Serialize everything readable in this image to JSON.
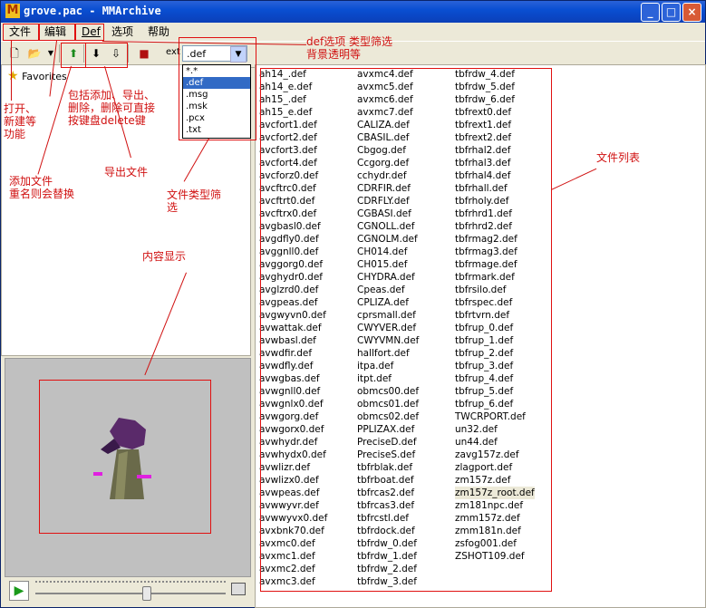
{
  "window": {
    "title": "grove.pac - MMArchive",
    "icon": "M"
  },
  "menubar": {
    "items": [
      "文件",
      "编辑",
      "Def",
      "选项",
      "帮助"
    ]
  },
  "toolbar": {
    "ext_label": "ext",
    "selected_filter": ".def"
  },
  "dropdown": {
    "options": [
      "*.*",
      ".def",
      ".msg",
      ".msk",
      ".pcx",
      ".txt"
    ]
  },
  "tree": {
    "favorites_label": "Favorites"
  },
  "files": {
    "col1": [
      "ah14_.def",
      "ah14_e.def",
      "ah15_.def",
      "ah15_e.def",
      "avcfort1.def",
      "avcfort2.def",
      "avcfort3.def",
      "avcfort4.def",
      "avcforz0.def",
      "avcftrc0.def",
      "avcftrt0.def",
      "avcftrx0.def",
      "avgbasl0.def",
      "avgdfly0.def",
      "avggnll0.def",
      "avggorg0.def",
      "avghydr0.def",
      "avglzrd0.def",
      "avgpeas.def",
      "avgwyvn0.def",
      "avwattak.def",
      "avwbasl.def",
      "avwdfir.def",
      "avwdfly.def",
      "avwgbas.def",
      "avwgnll0.def",
      "avwgnlx0.def",
      "avwgorg.def",
      "avwgorx0.def",
      "avwhydr.def",
      "avwhydx0.def",
      "avwlizr.def",
      "avwlizx0.def",
      "avwpeas.def",
      "avwwyvr.def",
      "avwwyvx0.def",
      "avxbnk70.def",
      "avxmc0.def",
      "avxmc1.def",
      "avxmc2.def",
      "avxmc3.def"
    ],
    "col2": [
      "avxmc4.def",
      "avxmc5.def",
      "avxmc6.def",
      "avxmc7.def",
      "CALIZA.def",
      "CBASIL.def",
      "Cbgog.def",
      "Ccgorg.def",
      "cchydr.def",
      "CDRFIR.def",
      "CDRFLY.def",
      "CGBASI.def",
      "CGNOLL.def",
      "CGNOLM.def",
      "CH014.def",
      "CH015.def",
      "CHYDRA.def",
      "Cpeas.def",
      "CPLIZA.def",
      "cprsmall.def",
      "CWYVER.def",
      "CWYVMN.def",
      "hallfort.def",
      "itpa.def",
      "itpt.def",
      "obmcs00.def",
      "obmcs01.def",
      "obmcs02.def",
      "PPLIZAX.def",
      "PreciseD.def",
      "PreciseS.def",
      "tbfrblak.def",
      "tbfrboat.def",
      "tbfrcas2.def",
      "tbfrcas3.def",
      "tbfrcstl.def",
      "tbfrdock.def",
      "tbfrdw_0.def",
      "tbfrdw_1.def",
      "tbfrdw_2.def",
      "tbfrdw_3.def"
    ],
    "col3": [
      "tbfrdw_4.def",
      "tbfrdw_5.def",
      "tbfrdw_6.def",
      "tbfrext0.def",
      "tbfrext1.def",
      "tbfrext2.def",
      "tbfrhal2.def",
      "tbfrhal3.def",
      "tbfrhal4.def",
      "tbfrhall.def",
      "tbfrholy.def",
      "tbfrhrd1.def",
      "tbfrhrd2.def",
      "tbfrmag2.def",
      "tbfrmag3.def",
      "tbfrmage.def",
      "tbfrmark.def",
      "tbfrsilo.def",
      "tbfrspec.def",
      "tbfrtvrn.def",
      "tbfrup_0.def",
      "tbfrup_1.def",
      "tbfrup_2.def",
      "tbfrup_3.def",
      "tbfrup_4.def",
      "tbfrup_5.def",
      "tbfrup_6.def",
      "TWCRPORT.def",
      "un32.def",
      "un44.def",
      "zavg157z.def",
      "zlagport.def",
      "zm157z.def",
      "zm157z_root.def",
      "zm181npc.def",
      "zmm157z.def",
      "zmm181n.def",
      "zsfog001.def",
      "ZSHOT109.def"
    ]
  },
  "annotations": {
    "def_options": "def选项 类型筛选",
    "bg_transparent": "背景透明等",
    "file_open": "打开、\n新建等\n功能",
    "add_export": "包括添加、导出、\n删除，删除可直接\n按键盘delete键",
    "add_file": "添加文件\n重名则会替换",
    "export_file": "导出文件",
    "file_type_filter": "文件类型筛\n选",
    "content_display": "内容显示",
    "file_list": "文件列表"
  }
}
